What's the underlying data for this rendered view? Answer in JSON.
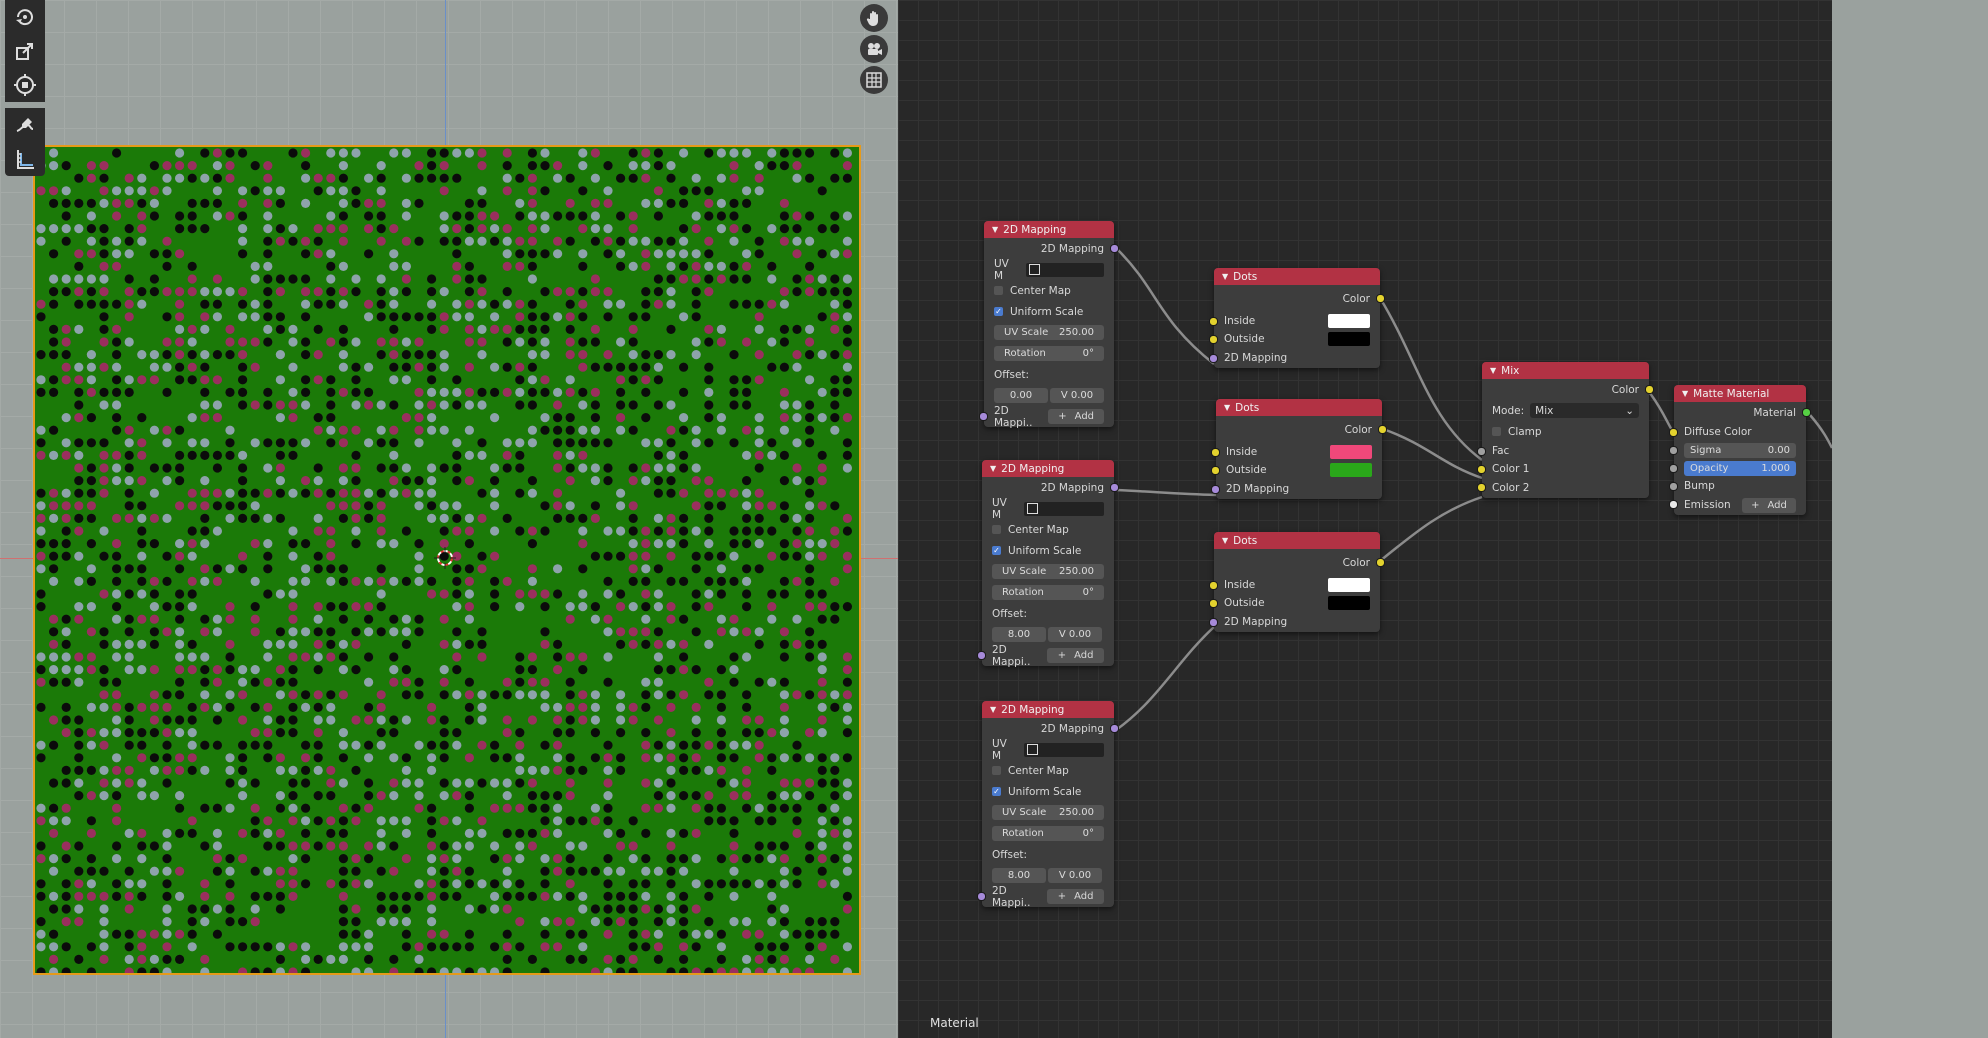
{
  "viewport": {
    "tools": [
      "rotate-tool-icon",
      "scale-tool-icon",
      "transform-tool-icon",
      "annotate-tool-icon",
      "measure-tool-icon"
    ],
    "gizmos": [
      "hand-pan-icon",
      "camera-icon",
      "grid-view-icon"
    ],
    "colors": {
      "plane": "#1b7a08",
      "border": "#e59a1a",
      "dot_black": "#0b0b0b",
      "dot_pink": "#9a2f5e",
      "dot_gray": "#8ea3ab"
    }
  },
  "editor": {
    "label": "Material",
    "mapping_nodes": [
      {
        "title": "2D Mapping",
        "output": "2D Mapping",
        "uv_label": "UV M",
        "center_map": "Center Map",
        "uniform_scale": "Uniform Scale",
        "uv_scale_label": "UV Scale",
        "uv_scale": "250.00",
        "rotation_label": "Rotation",
        "rotation": "0°",
        "offset_label": "Offset:",
        "offset_u": "0.00",
        "offset_v": "V  0.00",
        "input_label": "2D Mappi..",
        "add_label": "Add"
      },
      {
        "title": "2D Mapping",
        "output": "2D Mapping",
        "uv_label": "UV M",
        "center_map": "Center Map",
        "uniform_scale": "Uniform Scale",
        "uv_scale_label": "UV Scale",
        "uv_scale": "250.00",
        "rotation_label": "Rotation",
        "rotation": "0°",
        "offset_label": "Offset:",
        "offset_u": "8.00",
        "offset_v": "V  0.00",
        "input_label": "2D Mappi..",
        "add_label": "Add"
      },
      {
        "title": "2D Mapping",
        "output": "2D Mapping",
        "uv_label": "UV M",
        "center_map": "Center Map",
        "uniform_scale": "Uniform Scale",
        "uv_scale_label": "UV Scale",
        "uv_scale": "250.00",
        "rotation_label": "Rotation",
        "rotation": "0°",
        "offset_label": "Offset:",
        "offset_u": "8.00",
        "offset_v": "V  0.00",
        "input_label": "2D Mappi..",
        "add_label": "Add"
      }
    ],
    "dots_nodes": [
      {
        "title": "Dots",
        "output": "Color",
        "inside": "Inside",
        "outside": "Outside",
        "mapping": "2D Mapping",
        "inside_color": "#ffffff",
        "outside_color": "#000000"
      },
      {
        "title": "Dots",
        "output": "Color",
        "inside": "Inside",
        "outside": "Outside",
        "mapping": "2D Mapping",
        "inside_color": "#f0487a",
        "outside_color": "#2aa81a"
      },
      {
        "title": "Dots",
        "output": "Color",
        "inside": "Inside",
        "outside": "Outside",
        "mapping": "2D Mapping",
        "inside_color": "#ffffff",
        "outside_color": "#000000"
      }
    ],
    "mix_node": {
      "title": "Mix",
      "output": "Color",
      "mode_label": "Mode:",
      "mode_value": "Mix",
      "clamp": "Clamp",
      "fac": "Fac",
      "color1": "Color 1",
      "color2": "Color 2"
    },
    "matte_node": {
      "title": "Matte Material",
      "output": "Material",
      "diffuse": "Diffuse Color",
      "sigma_label": "Sigma",
      "sigma": "0.00",
      "opacity_label": "Opacity",
      "opacity": "1.000",
      "bump": "Bump",
      "emission": "Emission",
      "add_label": "Add"
    }
  }
}
